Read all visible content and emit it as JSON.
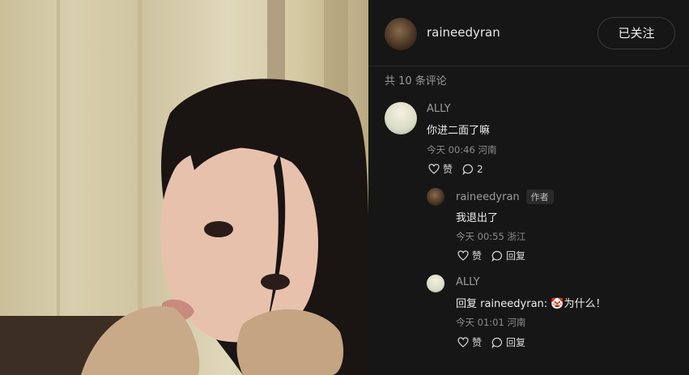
{
  "header": {
    "username": "raineedyran",
    "follow_label": "已关注"
  },
  "comments_count_label": "共 10 条评论",
  "comments": [
    {
      "user": "ALLY",
      "text": "你进二面了嘛",
      "time": "今天 00:46",
      "location": "河南",
      "like_label": "赞",
      "reply_count": "2"
    },
    {
      "user": "raineedyran",
      "badge": "作者",
      "text": "我退出了",
      "time": "今天 00:55",
      "location": "浙江",
      "like_label": "赞",
      "reply_label": "回复"
    },
    {
      "user": "ALLY",
      "text_prefix": "回复 raineedyran: ",
      "emoji": "🤡",
      "text_suffix": "为什么！",
      "time": "今天 01:01",
      "location": "河南",
      "like_label": "赞",
      "reply_label": "回复"
    }
  ],
  "icons": [
    "heart-icon",
    "comment-icon",
    "clown-emoji"
  ],
  "colors": {
    "panel_bg": "#161616",
    "text": "#ececec",
    "muted": "#8c8c8c"
  }
}
